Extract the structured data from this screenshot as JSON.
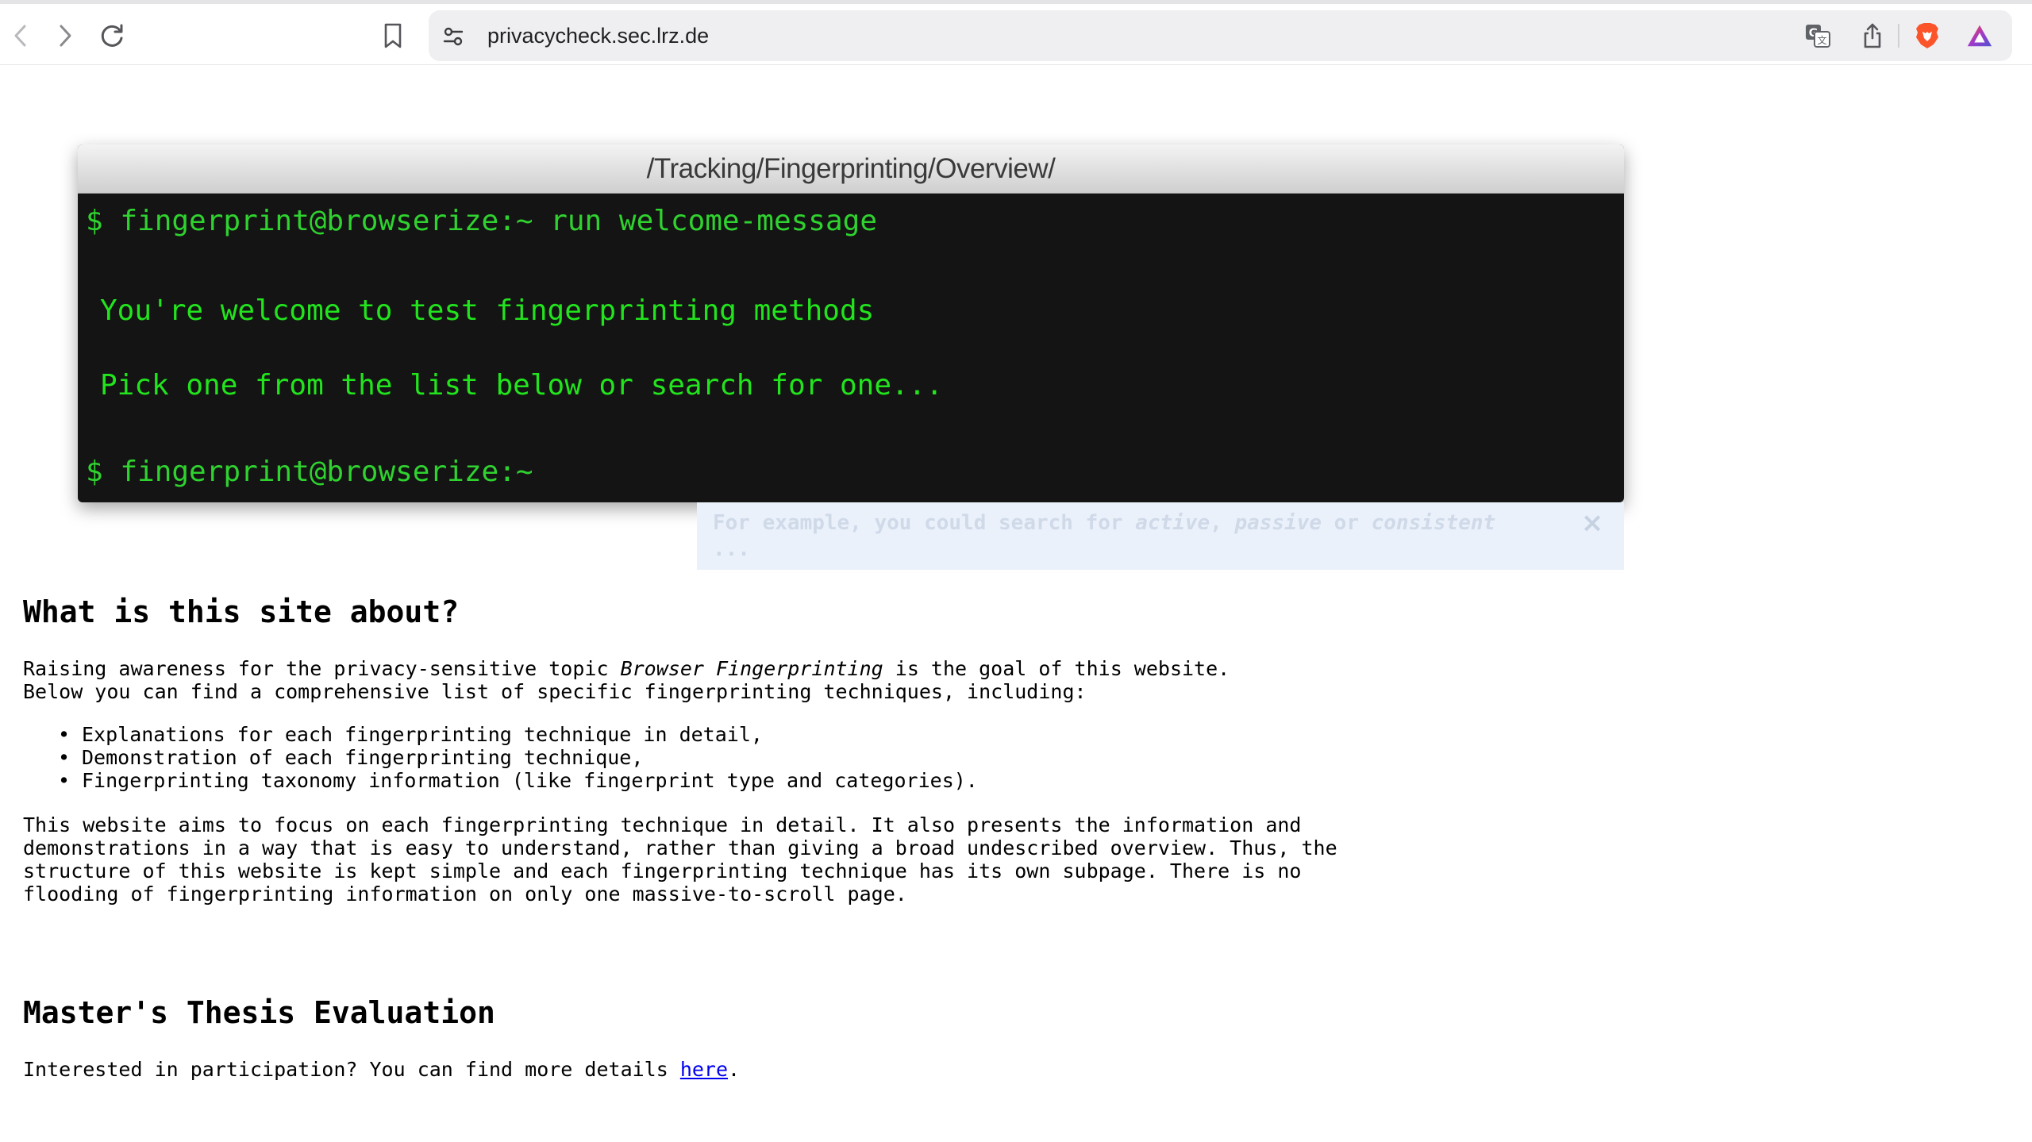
{
  "browser": {
    "url": "privacycheck.sec.lrz.de",
    "icons": {
      "back": "chevron-left-icon",
      "forward": "chevron-right-icon",
      "reload": "reload-icon",
      "bookmark": "bookmark-icon",
      "site_settings": "sliders-icon",
      "translate": "translate-icon",
      "share": "share-icon",
      "brave_shields": "brave-lion-icon",
      "rewards": "triangle-icon"
    },
    "colors": {
      "brave": "#fb542b",
      "rewards": "#a239ca"
    }
  },
  "terminal": {
    "title": "/Tracking/Fingerprinting/Overview/",
    "command_line": "$ fingerprint@browserize:~ run welcome-message",
    "welcome_line": "You're welcome to test fingerprinting methods",
    "pick_line": "Pick one from the list below or search for one...",
    "prompt_line": "$ fingerprint@browserize:~",
    "colors": {
      "background": "#141414",
      "text": "#22e41d"
    }
  },
  "search_hint": {
    "prefix": "For example, you could search for ",
    "kw1": "active",
    "sep1": ", ",
    "kw2": "passive",
    "sep2": " or ",
    "kw3": "consistent",
    "ellipsis": "...",
    "close": "×"
  },
  "about": {
    "heading": "What is this site about?",
    "intro_1a": "Raising awareness for the privacy-sensitive topic ",
    "intro_1b": "Browser Fingerprinting",
    "intro_1c": " is the goal of this website.",
    "intro_2": "Below you can find a comprehensive list of specific fingerprinting techniques, including:",
    "bullets": [
      "Explanations for each fingerprinting technique in detail,",
      "Demonstration of each fingerprinting technique,",
      "Fingerprinting taxonomy information (like fingerprint type and categories)."
    ],
    "aims_lines": [
      "This website aims to focus on each fingerprinting technique in detail. It also presents the information and",
      "demonstrations in a way that is easy to understand, rather than giving a broad undescribed overview. Thus, the",
      "structure of this website is kept simple and each fingerprinting technique has its own subpage. There is no",
      "flooding of fingerprinting information on only one massive-to-scroll page."
    ]
  },
  "thesis": {
    "heading": "Master's Thesis Evaluation",
    "text_before": "Interested in participation? You can find more details ",
    "link": "here",
    "text_after": "."
  }
}
